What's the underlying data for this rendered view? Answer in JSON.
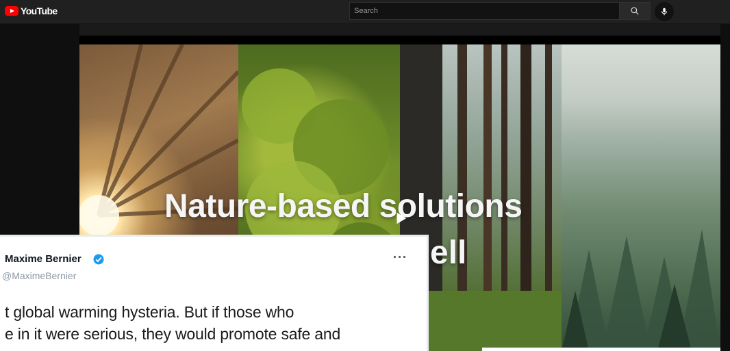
{
  "app": {
    "logo_text": "YouTube",
    "brand_color": "#ff0000"
  },
  "search": {
    "placeholder": "Search",
    "value": ""
  },
  "icons": {
    "search": "search-icon",
    "mic": "microphone-icon",
    "play": "play-icon",
    "verified": "verified-badge-icon",
    "more": "more-horizontal-icon"
  },
  "video": {
    "title_line1": "Nature-based solutions",
    "title_line2": "ell"
  },
  "tweet": {
    "author_name": "Maxime Bernier",
    "author_handle": "@MaximeBernier",
    "more_label": "···",
    "body_lines": [
      "t global warming hysteria. But if those who",
      "e in it were serious, they would promote safe and"
    ]
  }
}
